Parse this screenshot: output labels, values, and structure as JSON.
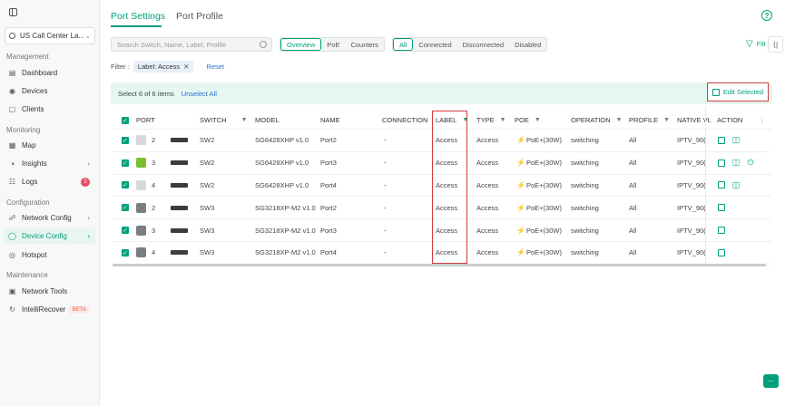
{
  "sidebar": {
    "site": "US Call Center La...",
    "sections": {
      "management": "Management",
      "monitoring": "Monitoring",
      "configuration": "Configuration",
      "maintenance": "Maintenance"
    },
    "items": {
      "dashboard": "Dashboard",
      "devices": "Devices",
      "clients": "Clients",
      "map": "Map",
      "insights": "Insights",
      "logs": "Logs",
      "logs_badge": "2",
      "network_config": "Network Config",
      "device_config": "Device Config",
      "hotspot": "Hotspot",
      "network_tools": "Network Tools",
      "intellirecover": "IntelliRecover",
      "beta": "BETA"
    }
  },
  "tabs": {
    "port_settings": "Port Settings",
    "port_profile": "Port Profile"
  },
  "toolbar": {
    "search_placeholder": "Search Switch, Name, Label, Profile",
    "view": [
      "Overview",
      "PoE",
      "Counters"
    ],
    "status": [
      "All",
      "Connected",
      "Disconnected",
      "Disabled"
    ],
    "filter": "Filt"
  },
  "filter_row": {
    "label": "Filter :",
    "chip": "Label: Access",
    "reset": "Reset"
  },
  "selection": {
    "text": "Select 6 of 6 items",
    "unselect": "Unselect All",
    "edit": "Edit Selected"
  },
  "table": {
    "headers": {
      "port": "PORT",
      "switch": "SWITCH",
      "model": "MODEL",
      "name": "NAME",
      "connection": "CONNECTION",
      "label": "LABEL",
      "type": "TYPE",
      "poe": "POE",
      "operation": "OPERATION",
      "profile": "PROFILE",
      "native": "NATIVE VL",
      "action": "ACTION"
    },
    "rows": [
      {
        "port": "2",
        "switch": "SW2",
        "model": "SG6428XHP v1.0",
        "name": "Port2",
        "connection": "-",
        "label": "Access",
        "type": "Access",
        "poe": "PoE+(30W)",
        "operation": "switching",
        "profile": "All",
        "native": "IPTV_90(",
        "port_color": "#d6d8d9"
      },
      {
        "port": "3",
        "switch": "SW2",
        "model": "SG6428XHP v1.0",
        "name": "Port3",
        "connection": "-",
        "label": "Access",
        "type": "Access",
        "poe": "PoE+(30W)",
        "operation": "switching",
        "profile": "All",
        "native": "IPTV_90(",
        "port_color": "#7cbf2e"
      },
      {
        "port": "4",
        "switch": "SW2",
        "model": "SG6428XHP v1.0",
        "name": "Port4",
        "connection": "-",
        "label": "Access",
        "type": "Access",
        "poe": "PoE+(30W)",
        "operation": "switching",
        "profile": "All",
        "native": "IPTV_90(",
        "port_color": "#d6d8d9"
      },
      {
        "port": "2",
        "switch": "SW3",
        "model": "SG3218XP-M2 v1.0",
        "name": "Port2",
        "connection": "-",
        "label": "Access",
        "type": "Access",
        "poe": "PoE+(30W)",
        "operation": "switching",
        "profile": "All",
        "native": "IPTV_90(",
        "port_color": "#7b7e80"
      },
      {
        "port": "3",
        "switch": "SW3",
        "model": "SG3218XP-M2 v1.0",
        "name": "Port3",
        "connection": "-",
        "label": "Access",
        "type": "Access",
        "poe": "PoE+(30W)",
        "operation": "switching",
        "profile": "All",
        "native": "IPTV_90(",
        "port_color": "#7b7e80"
      },
      {
        "port": "4",
        "switch": "SW3",
        "model": "SG3218XP-M2 v1.0",
        "name": "Port4",
        "connection": "-",
        "label": "Access",
        "type": "Access",
        "poe": "PoE+(30W)",
        "operation": "switching",
        "profile": "All",
        "native": "IPTV_90(",
        "port_color": "#7b7e80"
      }
    ]
  },
  "colors": {
    "accent": "#00a07d",
    "highlight_box": "#d13b3b",
    "link": "#2a6ed0"
  }
}
